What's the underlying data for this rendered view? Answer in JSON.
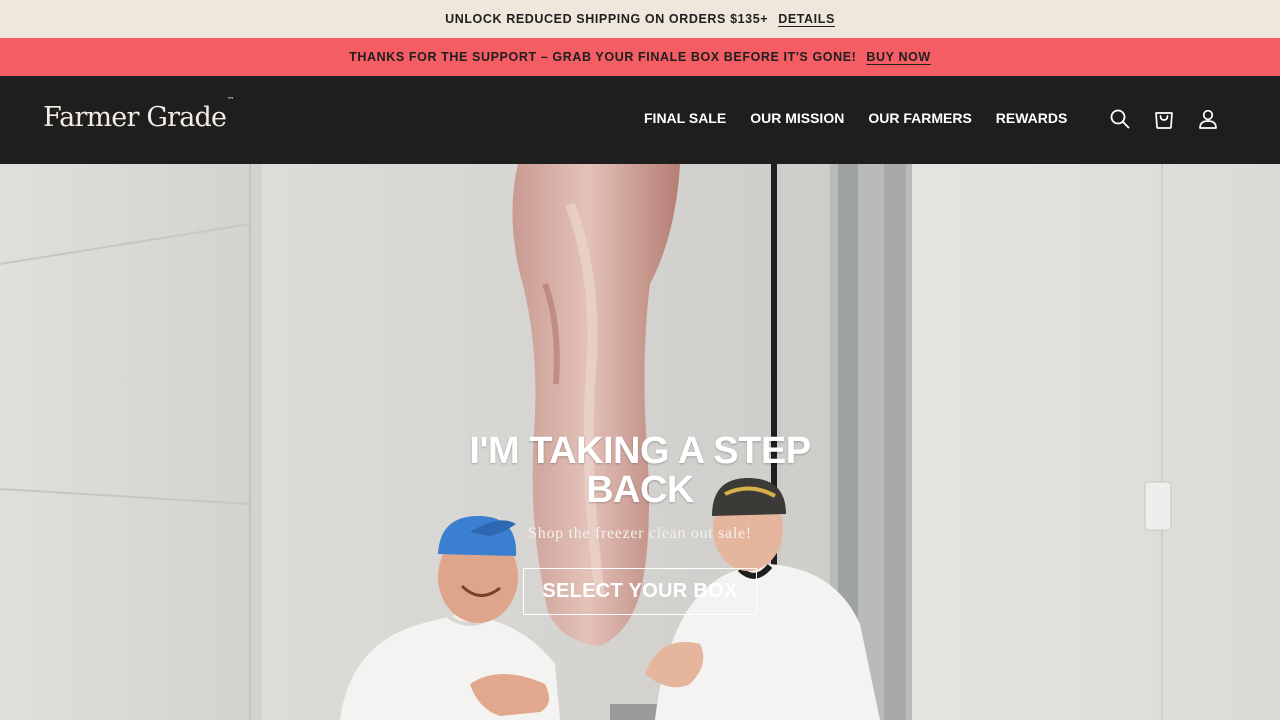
{
  "announcement_top": {
    "text": "UNLOCK REDUCED SHIPPING ON ORDERS $135+",
    "link_label": "DETAILS"
  },
  "announcement_promo": {
    "text": "THANKS FOR THE SUPPORT – GRAB YOUR FINALE BOX BEFORE IT'S GONE!",
    "link_label": "BUY NOW"
  },
  "header": {
    "logo": "Farmer Grade",
    "logo_mark": "™",
    "nav": [
      {
        "label": "FINAL SALE"
      },
      {
        "label": "OUR MISSION"
      },
      {
        "label": "OUR FARMERS"
      },
      {
        "label": "REWARDS"
      }
    ],
    "icons": [
      "search-icon",
      "cart-icon",
      "account-icon"
    ]
  },
  "hero": {
    "title": "I'M TAKING A STEP BACK",
    "subtitle": "Shop the freezer clean out sale!",
    "cta_label": "SELECT YOUR BOX"
  },
  "colors": {
    "announcement_top_bg": "#efe6dc",
    "announcement_promo_bg": "#f45d63",
    "header_bg": "#1e1e1e",
    "text_light": "#ffffff"
  }
}
